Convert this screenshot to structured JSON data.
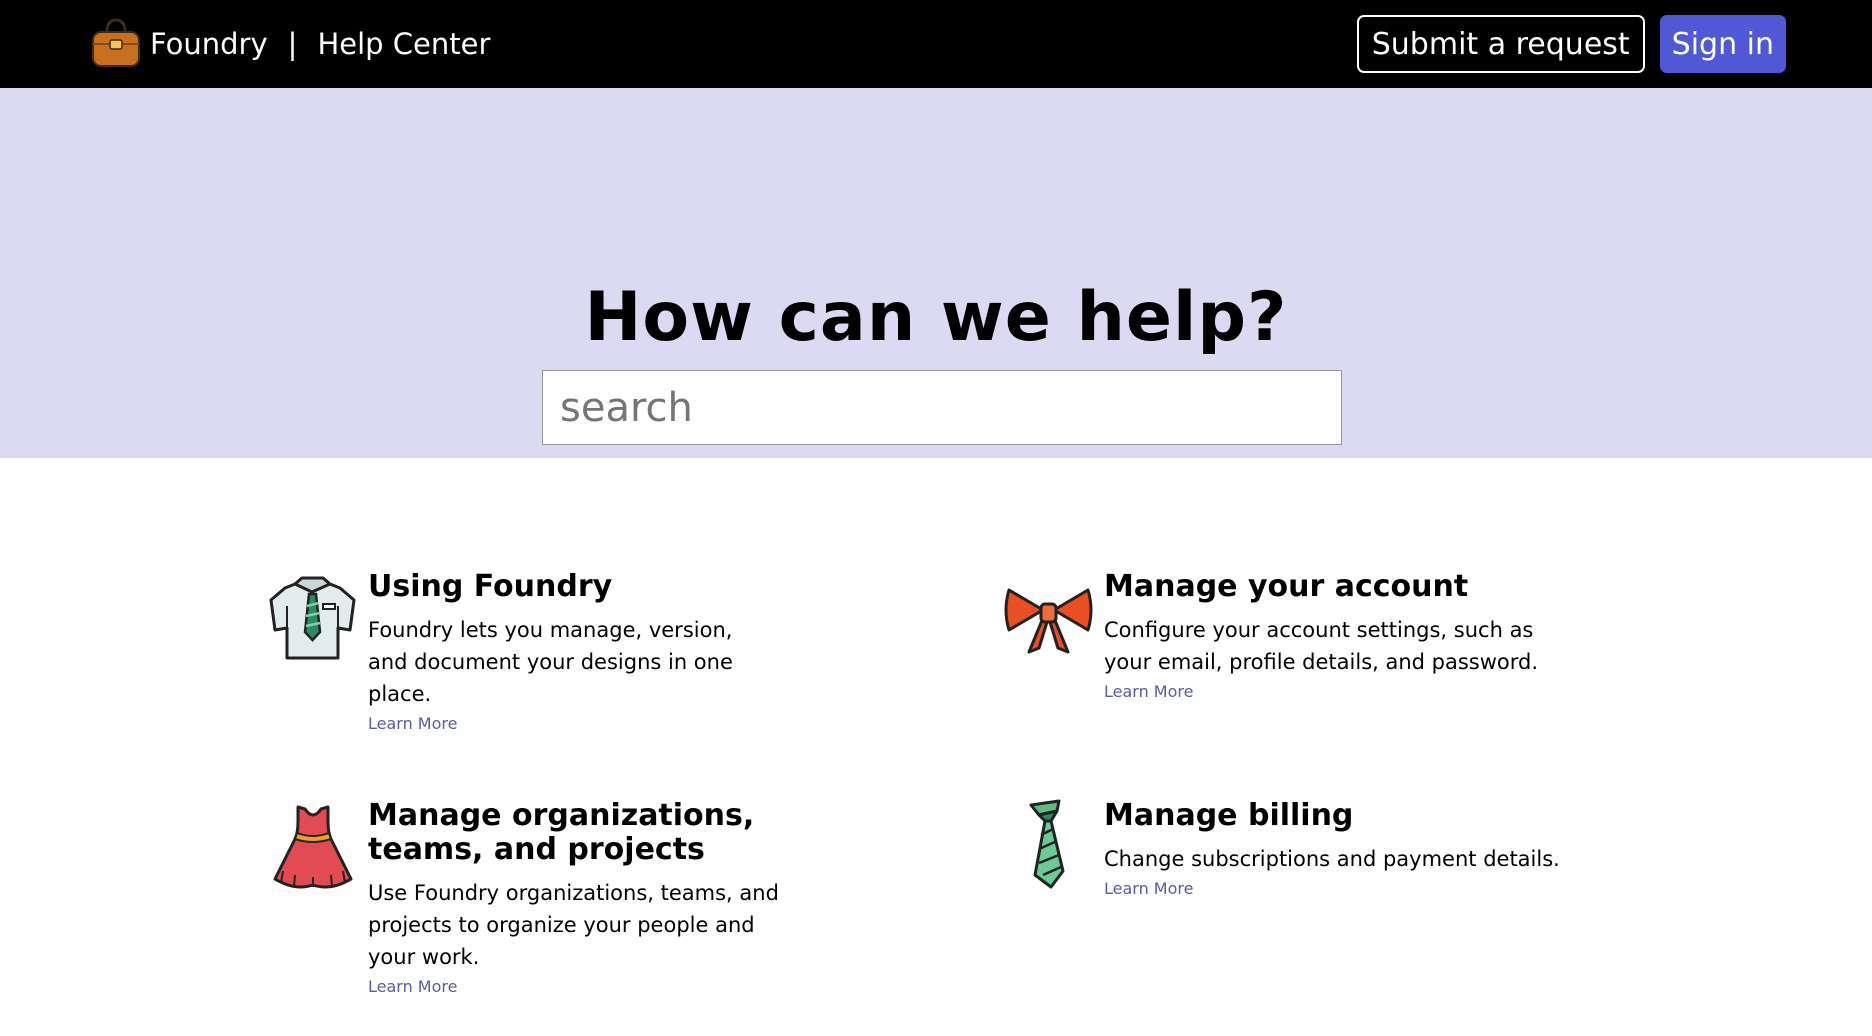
{
  "header": {
    "brand_name": "Foundry",
    "brand_separator": "|",
    "brand_subtitle": "Help Center",
    "logo_icon": "handbag-icon",
    "submit_label": "Submit a request",
    "signin_label": "Sign in",
    "signin_color": "#5158d6"
  },
  "hero": {
    "title": "How can we help?",
    "search_placeholder": "search",
    "background": "#dbdaf2"
  },
  "categories": [
    {
      "icon": "shirt-icon",
      "title": "Using Foundry",
      "description": "Foundry lets you manage, version, and document your designs in one place.",
      "link": "Learn More"
    },
    {
      "icon": "bow-icon",
      "title": "Manage your account",
      "description": "Configure your account settings, such as your email, profile details, and password.",
      "link": "Learn More"
    },
    {
      "icon": "dress-icon",
      "title": "Manage organizations, teams, and projects",
      "description": "Use Foundry organizations, teams, and projects to organize your people and your work.",
      "link": "Learn More"
    },
    {
      "icon": "necktie-icon",
      "title": "Manage billing",
      "description": "Change subscriptions and payment details.",
      "link": "Learn More"
    }
  ]
}
